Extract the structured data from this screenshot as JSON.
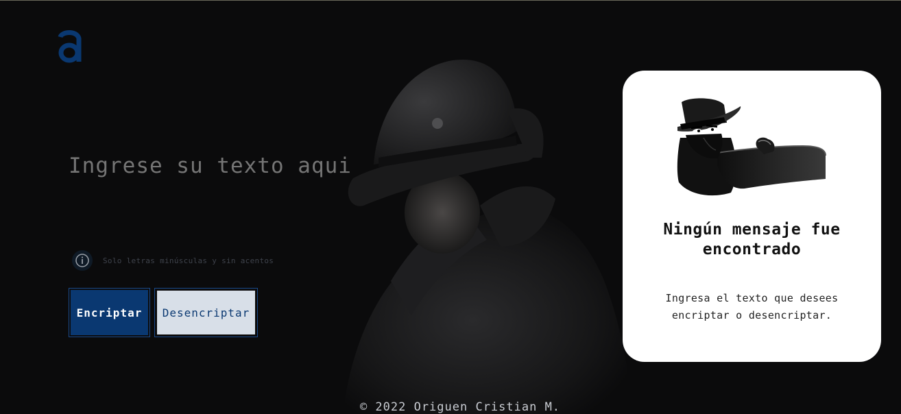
{
  "header": {
    "logo_icon": "alura-a-logo",
    "logo_color": "#0a3871"
  },
  "main": {
    "input_placeholder": "Ingrese su texto aqui",
    "hint_icon": "info-icon",
    "hint_text": "Solo letras minúsculas y sin acentos",
    "encrypt_label": "Encriptar",
    "decrypt_label": "Desencriptar",
    "background_image": "spy-in-hat-photo"
  },
  "output_panel": {
    "illustration": "spy-illustration",
    "title": "Ningún mensaje fue encontrado",
    "text": "Ingresa el texto que desees encriptar o desencriptar."
  },
  "footer": {
    "text": "© 2022 Origuen Cristian M."
  },
  "colors": {
    "background": "#0b0b0c",
    "accent": "#0a3871",
    "secondary_button": "#d8dfe8",
    "panel": "#ffffff"
  }
}
